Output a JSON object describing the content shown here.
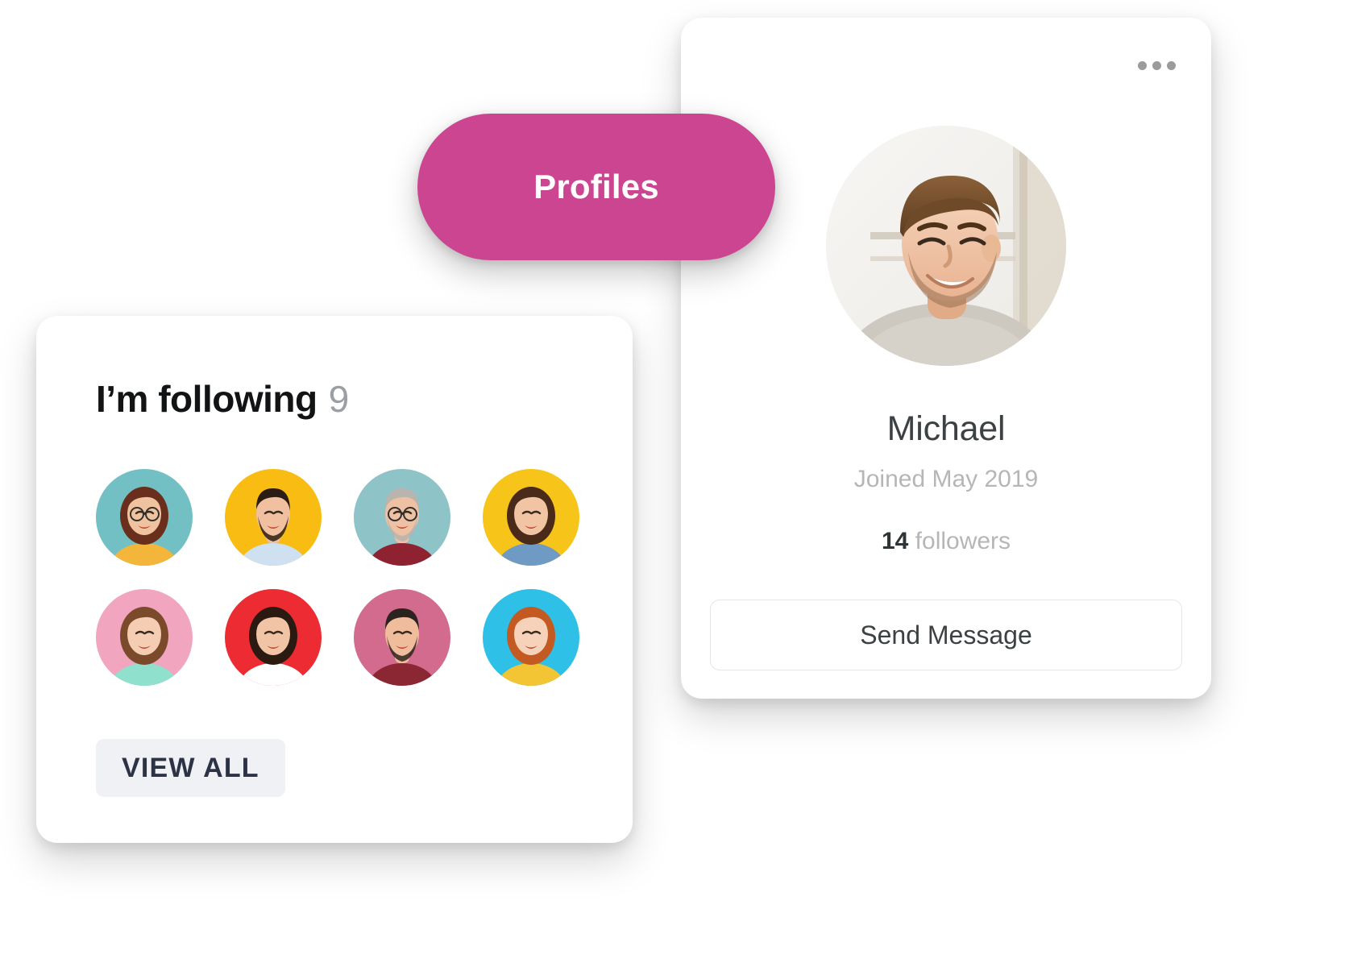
{
  "pill": {
    "label": "Profiles",
    "color": "#cc4590",
    "text_color": "#ffffff",
    "icon": "none"
  },
  "profile_card": {
    "menu_icon": "more-horizontal-icon",
    "avatar_alt": "michael-photo",
    "name": "Michael",
    "joined": "Joined May 2019",
    "followers_count": "14",
    "followers_label": "followers",
    "action_button": "Send Message"
  },
  "following_card": {
    "title": "I’m following",
    "count": "9",
    "view_all_button": "VIEW ALL",
    "avatars": [
      {
        "name": "avatar-1",
        "bg": "#73c0c4",
        "hair": "#6a2f1c",
        "skin": "#f0c3a0",
        "shirt": "#f3b63b",
        "style": "curly-glasses"
      },
      {
        "name": "avatar-2",
        "bg": "#f9bc13",
        "hair": "#2b1d14",
        "skin": "#f0c0a0",
        "shirt": "#cfe0f0",
        "style": "short-beard"
      },
      {
        "name": "avatar-3",
        "bg": "#8ec3c8",
        "hair": "#b9b4ae",
        "skin": "#eec0a4",
        "shirt": "#8e2230",
        "style": "glasses-gray-beard"
      },
      {
        "name": "avatar-4",
        "bg": "#f7c51a",
        "hair": "#4a2a18",
        "skin": "#f1c4a4",
        "shirt": "#6f9ac4",
        "style": "long-denim"
      },
      {
        "name": "avatar-5",
        "bg": "#f2a5bf",
        "hair": "#7a4a2b",
        "skin": "#f4cdb2",
        "shirt": "#8fe0cd",
        "style": "long-straight"
      },
      {
        "name": "avatar-6",
        "bg": "#ed2b32",
        "hair": "#2b1a12",
        "skin": "#f2c4a6",
        "shirt": "#ffffff",
        "style": "long-wavy"
      },
      {
        "name": "avatar-7",
        "bg": "#d26b8e",
        "hair": "#2b2320",
        "skin": "#efbd9c",
        "shirt": "#8b2733",
        "style": "short-beard"
      },
      {
        "name": "avatar-8",
        "bg": "#2ec0e6",
        "hair": "#c25a22",
        "skin": "#f6d2ba",
        "shirt": "#f3c433",
        "style": "long-straight"
      }
    ]
  }
}
